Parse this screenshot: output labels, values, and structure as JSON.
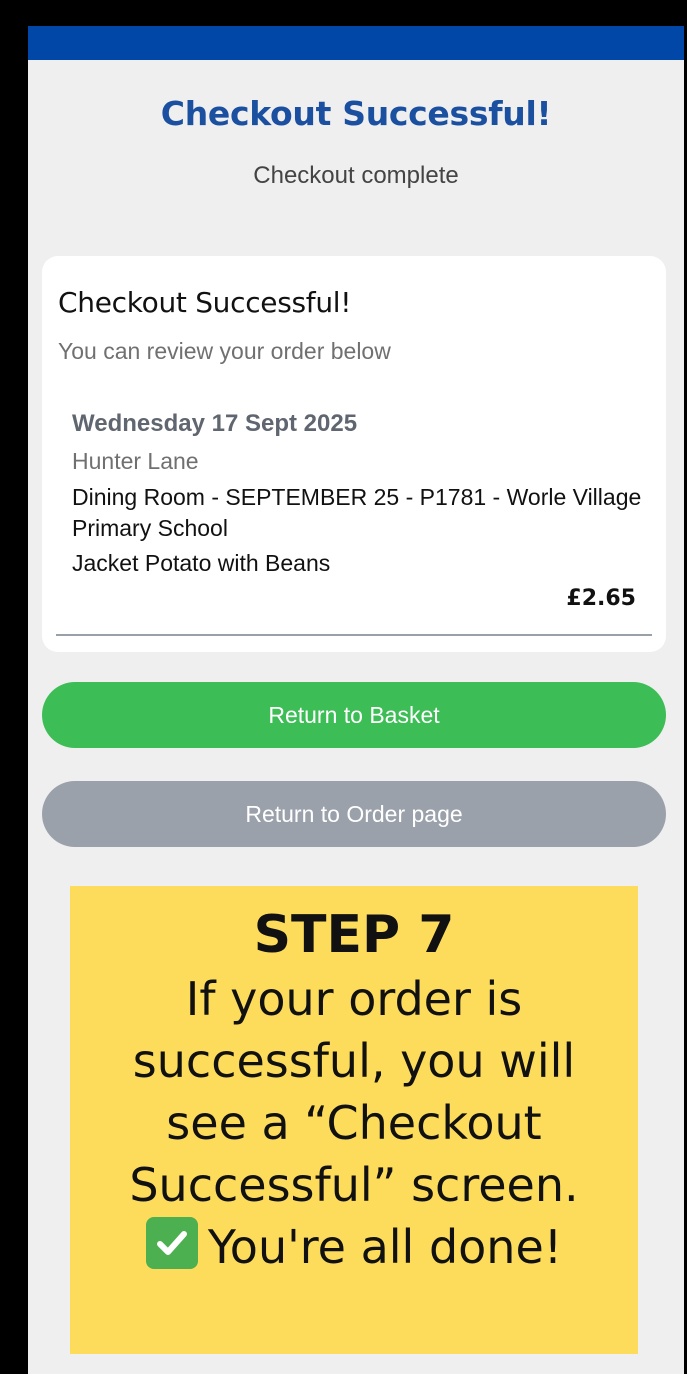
{
  "header": {
    "title": "Checkout Successful!",
    "subtitle": "Checkout complete",
    "bar_color": "#0047a8"
  },
  "card": {
    "title": "Checkout Successful!",
    "subtitle": "You can review your order below",
    "order": {
      "date": "Wednesday 17 Sept 2025",
      "location": "Hunter Lane",
      "menu": "Dining Room - SEPTEMBER 25 - P1781 - Worle Village Primary School",
      "item": "Jacket Potato with Beans",
      "price": "£2.65"
    }
  },
  "buttons": {
    "return_basket": "Return to Basket",
    "return_order": "Return to Order page",
    "basket_color": "#3dbd56",
    "order_color": "#9ba1ab"
  },
  "instruction": {
    "step": "STEP 7",
    "lines": [
      "If your order is",
      "successful, you will",
      "see a “Checkout",
      "Successful” screen.",
      "You're all done!"
    ],
    "icon": "check-mark-icon",
    "background_color": "#fddc5c"
  }
}
